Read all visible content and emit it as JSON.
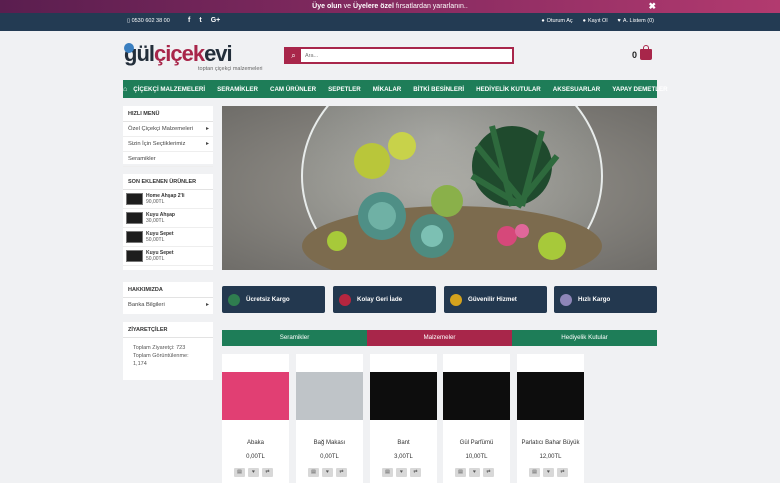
{
  "promo": {
    "part1": "Üye olun",
    "part2": " ve ",
    "part3": "Üyelere özel",
    "part4": " fırsatlardan yararlanın..",
    "close": "✖"
  },
  "topbar": {
    "phone": "0530 602 38 00",
    "social": [
      "f",
      "t",
      "G+"
    ],
    "login": "Oturum Aç",
    "register": "Kayıt Ol",
    "wishlist": "A. Listem (0)"
  },
  "header": {
    "logo_part1": "gül",
    "logo_part2": "çiçek",
    "logo_part3": "evi",
    "logo_tagline": "toptan çiçekçi malzemeleri",
    "search_placeholder": "Ara...",
    "cart_count": "0"
  },
  "nav": {
    "items": [
      "ÇİÇEKÇİ MALZEMELERİ",
      "SERAMİKLER",
      "CAM ÜRÜNLER",
      "SEPETLER",
      "MİKALAR",
      "BİTKİ BESİNLERİ",
      "HEDİYELİK KUTULAR",
      "AKSESUARLAR",
      "YAPAY DEMETLER"
    ]
  },
  "sidebar": {
    "quick_menu_title": "HIZLI MENÜ",
    "quick_menu": [
      "Özel Çiçekçi Malzemeleri",
      "Sizin İçin Seçtiklerimiz",
      "Seramikler"
    ],
    "recent_title": "SON EKLENEN ÜRÜNLER",
    "recent": [
      {
        "name": "Home Ahşap 2'li",
        "price": "90,00TL"
      },
      {
        "name": "Kuyu Ahşap",
        "price": "30,00TL"
      },
      {
        "name": "Kuyu Sepet",
        "price": "50,00TL"
      },
      {
        "name": "Kuyu Sepet",
        "price": "50,00TL"
      }
    ],
    "about_title": "HAKKIMIZDA",
    "about_link": "Banka Bilgileri",
    "visitors_title": "ZİYARETÇİLER",
    "visitors_line1": "Toplam Ziyaretçi: 723",
    "visitors_line2": "Toplam Görüntülenme:",
    "visitors_line3": "1,174"
  },
  "features": [
    {
      "label": "Ücretsiz Kargo",
      "icon": "leaf-icon",
      "color": "#2f7d4f"
    },
    {
      "label": "Kolay Geri İade",
      "icon": "flower-icon",
      "color": "#b5263f"
    },
    {
      "label": "Güvenilir Hizmet",
      "icon": "shield-icon",
      "color": "#d4a21d"
    },
    {
      "label": "Hızlı Kargo",
      "icon": "gift-icon",
      "color": "#8e86b8"
    }
  ],
  "tabs": [
    "Seramikler",
    "Malzemeler",
    "Hediyelik Kutular"
  ],
  "products": [
    {
      "name": "Abaka",
      "price": "0,00TL"
    },
    {
      "name": "Bağ Makası",
      "price": "0,00TL"
    },
    {
      "name": "Bant",
      "price": "3,00TL"
    },
    {
      "name": "Gül Parfümü",
      "price": "10,00TL"
    },
    {
      "name": "Parlatıcı Bahar Büyük",
      "price": "12,00TL"
    }
  ],
  "colors": {
    "brand_red": "#a8264a",
    "brand_green": "#1e7d58",
    "dark_navy": "#23384f"
  }
}
